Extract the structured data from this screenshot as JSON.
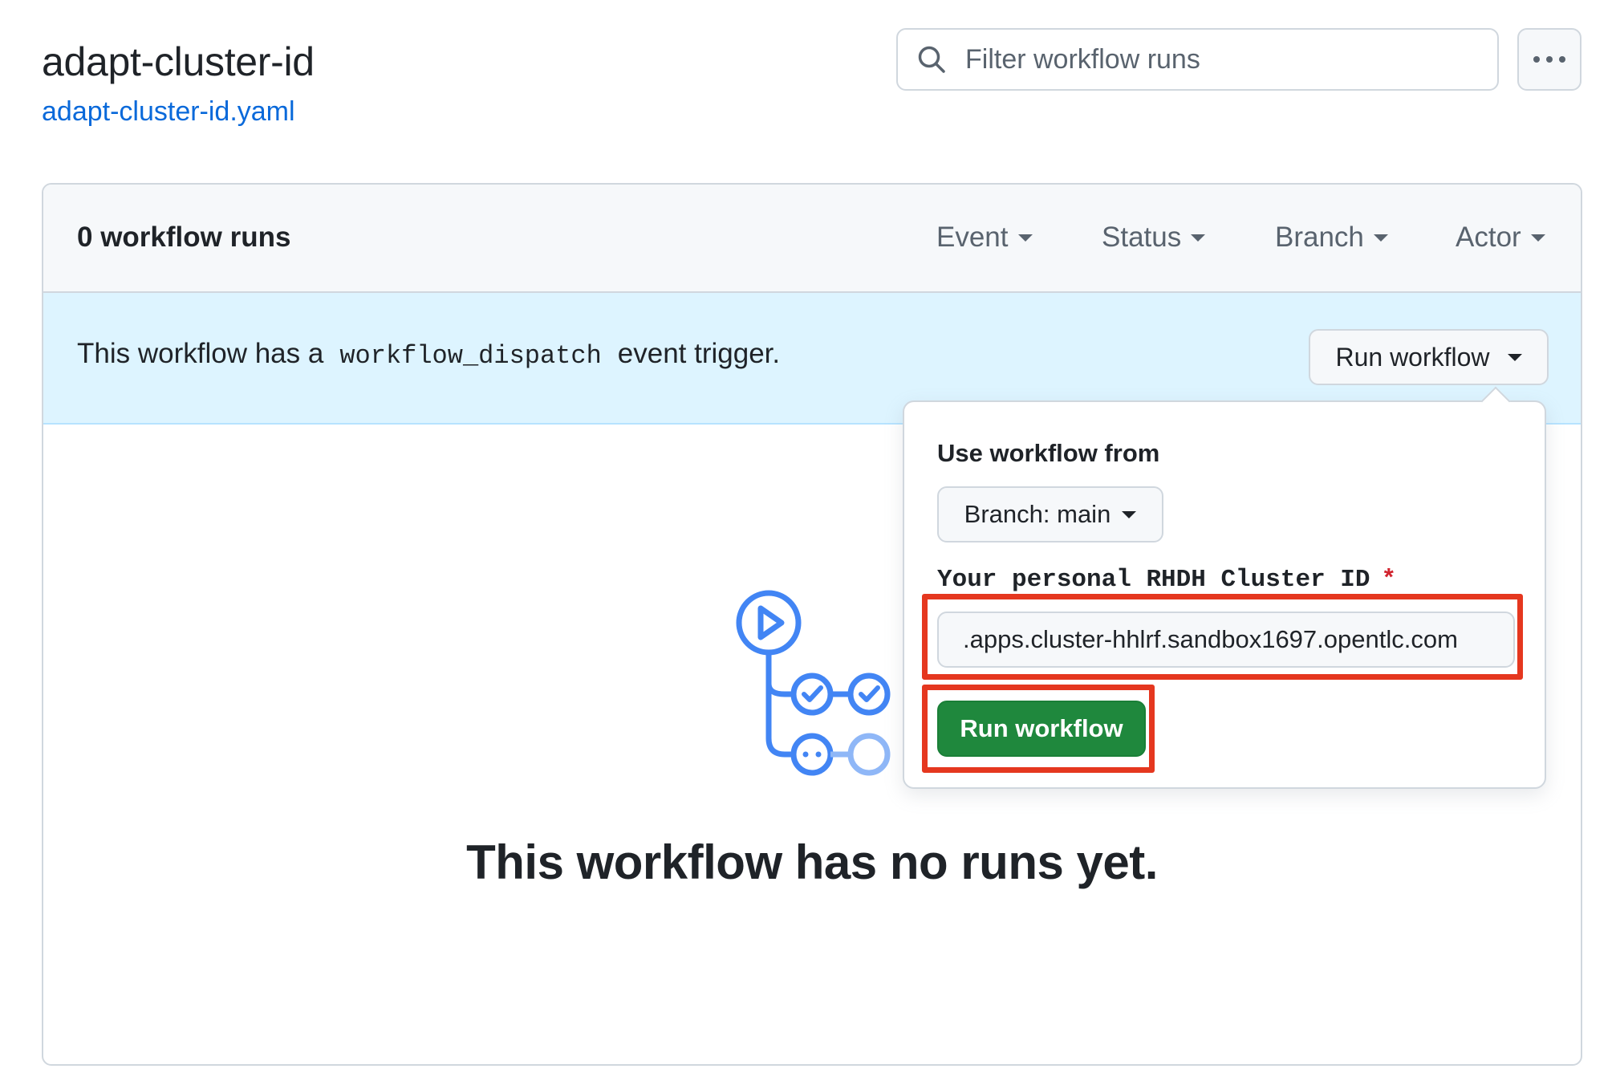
{
  "header": {
    "title": "adapt-cluster-id",
    "file_link": "adapt-cluster-id.yaml",
    "search_placeholder": "Filter workflow runs"
  },
  "runs_box": {
    "count_label": "0 workflow runs",
    "filters": [
      "Event",
      "Status",
      "Branch",
      "Actor"
    ]
  },
  "banner": {
    "text_before": "This workflow has a",
    "code": "workflow_dispatch",
    "text_after": "event trigger.",
    "run_button": "Run workflow"
  },
  "dropdown": {
    "use_from_label": "Use workflow from",
    "branch_button": "Branch: main",
    "field_label": "Your personal RHDH Cluster ID",
    "required_mark": "*",
    "field_value": ".apps.cluster-hhlrf.sandbox1697.opentlc.com",
    "submit_label": "Run workflow"
  },
  "empty_state": {
    "title": "This workflow has no runs yet."
  },
  "colors": {
    "link": "#0969da",
    "banner_bg": "#ddf4ff",
    "run_green": "#1f883d",
    "highlight": "#e5371f",
    "illustration_blue": "#4285f4"
  }
}
